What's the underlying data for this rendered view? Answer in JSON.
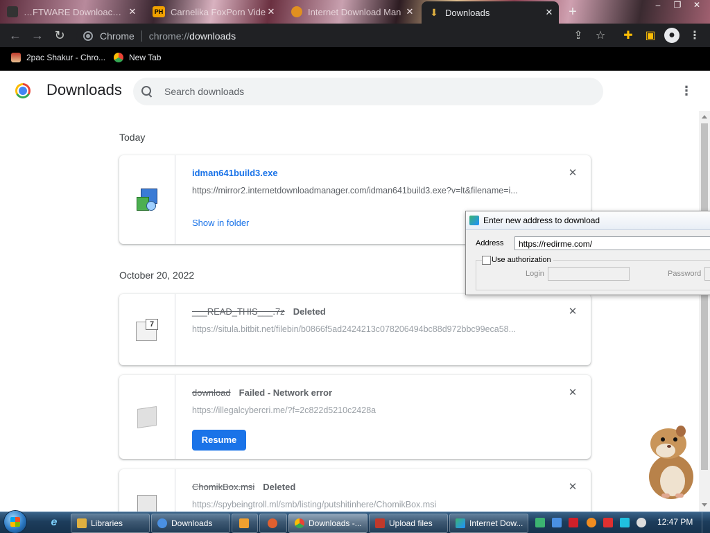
{
  "tabs": [
    {
      "label": "…FTWARE Downloac…",
      "icon_color": "#333333"
    },
    {
      "label": "Carnelika FoxPorn Vide",
      "icon_text": "PH",
      "icon_color": "#f0a000"
    },
    {
      "label": "Internet Download Man",
      "icon_color": "#e09020"
    },
    {
      "label": "Downloads",
      "icon_color": "#e0b040",
      "active": true
    }
  ],
  "address_bar": {
    "site": "Chrome",
    "scheme": "chrome://",
    "host": "downloads"
  },
  "bookmarks": [
    {
      "label": "2pac Shakur - Chro...",
      "icon": "bookmark-icon"
    },
    {
      "label": "New Tab",
      "icon": "chrome-icon"
    }
  ],
  "page": {
    "title": "Downloads",
    "search_placeholder": "Search downloads",
    "menu_icon": "more-vert-icon"
  },
  "sections": [
    {
      "date": "Today"
    },
    {
      "date": "October 20, 2022"
    }
  ],
  "downloads": [
    {
      "filename": "idman641build3.exe",
      "status": "",
      "url": "https://mirror2.internetdownloadmanager.com/idman641build3.exe?v=lt&filename=i...",
      "action": "Show in folder",
      "icon": "exe-icon"
    },
    {
      "filename": "___READ_THIS___.7z",
      "status": "Deleted",
      "url": "https://situla.bitbit.net/filebin/b0866f5ad2424213c078206494bc88d972bbc99eca58...",
      "icon": "archive-icon"
    },
    {
      "filename": "download",
      "status": "Failed - Network error",
      "url": "https://illegalcybercri.me/?f=2c822d5210c2428a",
      "action": "Resume",
      "icon": "file-icon"
    },
    {
      "filename": "ChomikBox.msi",
      "status": "Deleted",
      "url": "https://spybeingtroll.ml/smb/listing/putshitinhere/ChomikBox.msi",
      "icon": "installer-icon"
    }
  ],
  "idm_dialog": {
    "title": "Enter new address to download",
    "address_label": "Address",
    "address_value": "https://redirme.com/",
    "use_auth_label": "Use authorization",
    "login_label": "Login",
    "password_label": "Password"
  },
  "taskbar": {
    "pinned": [
      "ie-icon"
    ],
    "items": [
      {
        "label": "Libraries",
        "icon_color": "#e0b040"
      },
      {
        "label": "Downloads",
        "icon_color": "#4a90e2"
      },
      {
        "label": "",
        "icon_color": "#f0a030"
      },
      {
        "label": "",
        "icon_color": "#e06030"
      },
      {
        "label": "Downloads -...",
        "icon_color": "#db4437",
        "active": true
      },
      {
        "label": "Upload files",
        "icon_color": "#c0392b"
      },
      {
        "label": "Internet Dow...",
        "icon_color": "#3cb371"
      }
    ],
    "clock": "12:47 PM"
  },
  "colors": {
    "accent": "#1a73e8",
    "toolbar_bg": "#202124",
    "bookmarks_bg": "#000000"
  }
}
